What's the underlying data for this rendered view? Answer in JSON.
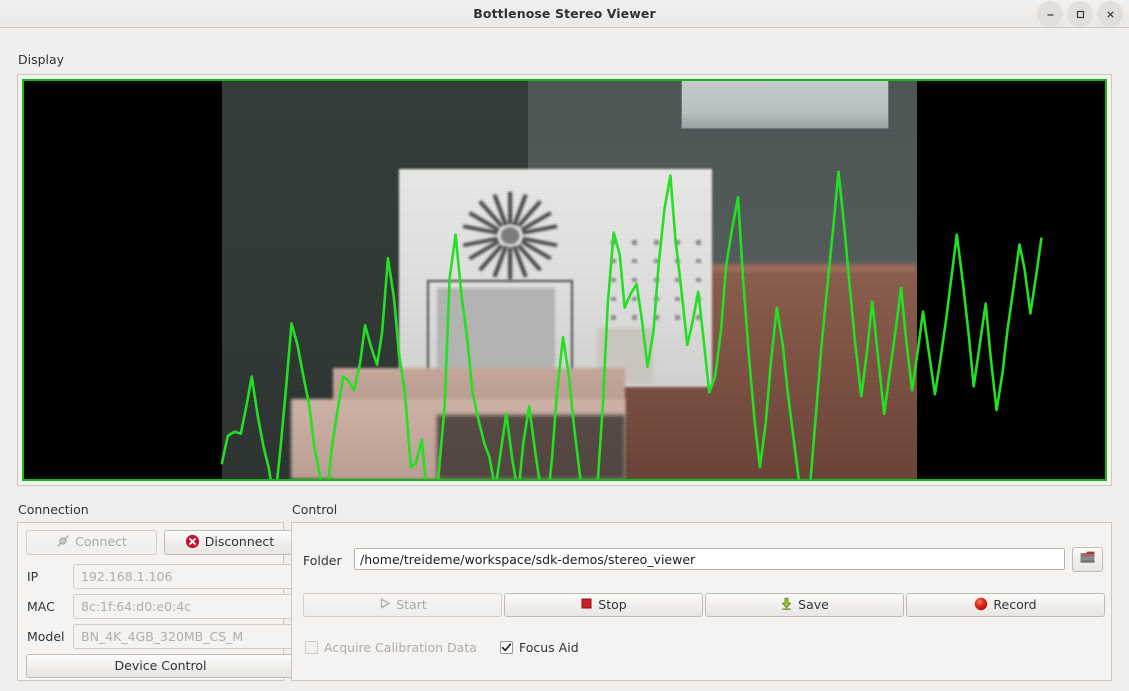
{
  "window": {
    "title": "Bottlenose Stereo Viewer",
    "buttons": {
      "minimize": "minimize",
      "maximize": "maximize",
      "close": "close"
    }
  },
  "display": {
    "label": "Display",
    "border_color": "#14b814",
    "overlay_color": "#22e022",
    "letterbox_color": "#000000",
    "overlay_name": "focus-aid-waveform"
  },
  "connection": {
    "label": "Connection",
    "connect_label": "Connect",
    "connect_enabled": false,
    "disconnect_label": "Disconnect",
    "disconnect_enabled": true,
    "fields": [
      {
        "label": "IP",
        "value": "192.168.1.106"
      },
      {
        "label": "MAC",
        "value": "8c:1f:64:d0:e0:4c"
      },
      {
        "label": "Model",
        "value": "BN_4K_4GB_320MB_CS_M"
      }
    ],
    "device_control_label": "Device Control"
  },
  "control": {
    "label": "Control",
    "folder_label": "Folder",
    "folder_value": "/home/treideme/workspace/sdk-demos/stereo_viewer",
    "browse_icon": "folder-icon",
    "start_label": "Start",
    "start_enabled": false,
    "stop_label": "Stop",
    "stop_enabled": true,
    "save_label": "Save",
    "save_enabled": true,
    "record_label": "Record",
    "record_enabled": true,
    "acquire_calibration_label": "Acquire Calibration Data",
    "acquire_calibration_checked": false,
    "acquire_calibration_enabled": false,
    "focus_aid_label": "Focus Aid",
    "focus_aid_checked": true,
    "focus_aid_enabled": true
  },
  "colors": {
    "accent_green": "#22e022",
    "stop_red": "#cc1f1f",
    "record_red": "#dd2222",
    "disconnect_red": "#c8102e",
    "save_green": "#9acd32"
  }
}
